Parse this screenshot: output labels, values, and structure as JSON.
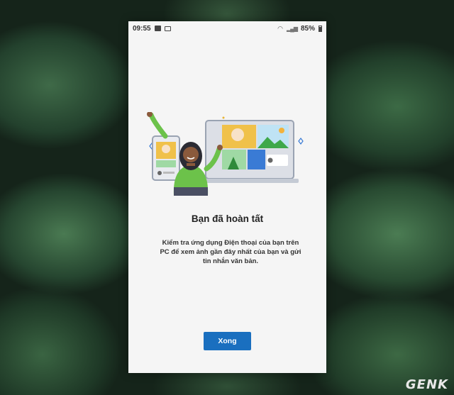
{
  "status_bar": {
    "time": "09:55",
    "battery": "85%",
    "icons": [
      "sim-icon",
      "image-icon",
      "wifi-icon",
      "signal-icon",
      "battery-icon"
    ]
  },
  "screen": {
    "illustration": "person-with-devices-illustration",
    "title": "Bạn đã hoàn tất",
    "description": "Kiểm tra ứng dụng Điện thoại của bạn trên PC để xem ảnh gần đây nhất của bạn và gửi tin nhắn văn bản.",
    "done_button": "Xong"
  },
  "watermark": "GENK",
  "colors": {
    "accent": "#1a6fbf",
    "background": "#f5f5f5"
  }
}
